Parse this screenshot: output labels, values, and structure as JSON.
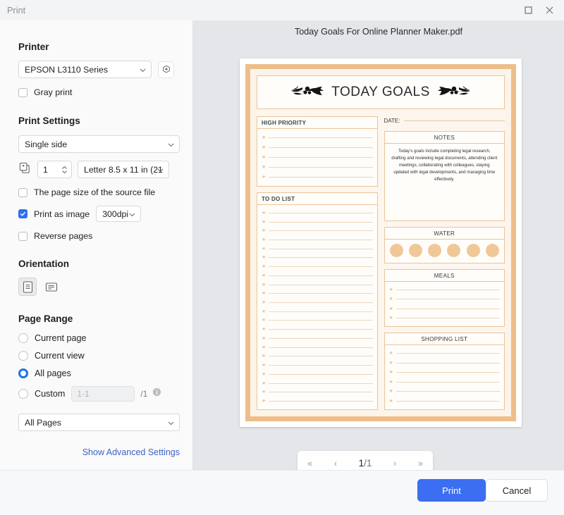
{
  "window": {
    "title": "Print",
    "maximize_icon": "maximize-icon",
    "close_icon": "close-icon"
  },
  "sidebar": {
    "printer": {
      "heading": "Printer",
      "selected": "EPSON L3110 Series",
      "settings_icon": "gear-icon",
      "gray_print": {
        "label": "Gray print",
        "checked": false
      }
    },
    "print_settings": {
      "heading": "Print Settings",
      "duplex": "Single side",
      "copies_icon": "copies-icon",
      "copies": "1",
      "paper_size": "Letter 8.5 x 11 in (21",
      "source_page_size": {
        "label": "The page size of the source file",
        "checked": false
      },
      "print_as_image": {
        "label": "Print as image",
        "checked": true
      },
      "dpi": "300dpi",
      "reverse_pages": {
        "label": "Reverse pages",
        "checked": false
      }
    },
    "orientation": {
      "heading": "Orientation",
      "portrait_icon": "portrait-icon",
      "landscape_icon": "landscape-icon",
      "selected": "portrait"
    },
    "page_range": {
      "heading": "Page Range",
      "options": [
        {
          "label": "Current page",
          "selected": false
        },
        {
          "label": "Current view",
          "selected": false
        },
        {
          "label": "All pages",
          "selected": true
        },
        {
          "label": "Custom",
          "selected": false
        }
      ],
      "custom_placeholder": "1-1",
      "custom_total": "/1",
      "info_icon": "info-icon",
      "subset": "All Pages"
    },
    "advanced_link": "Show Advanced Settings"
  },
  "preview": {
    "document_title": "Today Goals For Online Planner Maker.pdf",
    "page_nav": {
      "first_icon": "first-page-icon",
      "prev_icon": "prev-page-icon",
      "current": "1",
      "total": "/1",
      "next_icon": "next-page-icon",
      "last_icon": "last-page-icon"
    },
    "document": {
      "header_title": "TODAY GOALS",
      "flourish_left": "flourish-icon",
      "flourish_right": "flourish-icon",
      "date_label": "DATE:",
      "high_priority": {
        "title": "HIGH PRIORITY",
        "lines": 5
      },
      "to_do_list": {
        "title": "TO DO LIST",
        "lines": 22
      },
      "notes": {
        "title": "NOTES",
        "body": "Today's goals include completing legal research, drafting and reviewing legal documents, attending client meetings, collaborating with colleagues, staying updated with legal developments, and managing time effectively."
      },
      "water": {
        "title": "WATER",
        "glasses": 6
      },
      "meals": {
        "title": "MEALS",
        "lines": 4
      },
      "shopping_list": {
        "title": "SHOPPING LIST",
        "lines": 6
      }
    }
  },
  "footer": {
    "print_label": "Print",
    "cancel_label": "Cancel"
  },
  "colors": {
    "accent": "#3b6ef0",
    "radio_accent": "#1a73e8",
    "link": "#3b63c6",
    "page_border": "#edbe8a",
    "star": "#edc28f"
  }
}
